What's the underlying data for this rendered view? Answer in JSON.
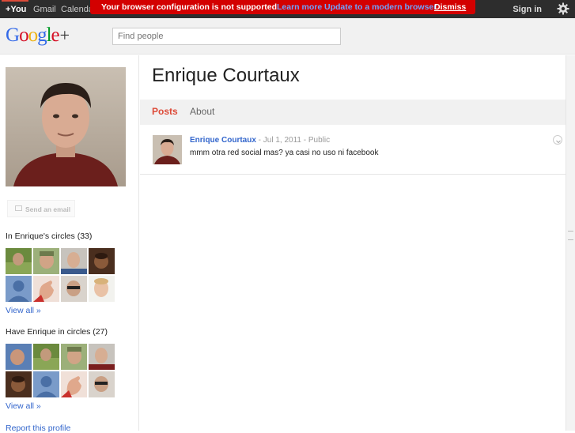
{
  "topbar": {
    "you": "+You",
    "gmail": "Gmail",
    "calendar": "Calendar",
    "signin": "Sign in",
    "settings_icon": "gear-icon"
  },
  "banner": {
    "message": "Your browser configuration is not supported.",
    "learn_more": "Learn more",
    "update": "Update to a modern browser",
    "dismiss": "Dismiss",
    "color": "#d30000"
  },
  "header": {
    "logo": {
      "g": "G",
      "o1": "o",
      "o2": "o",
      "g2": "g",
      "l": "l",
      "e": "e",
      "plus": "+"
    },
    "search_placeholder": "Find people"
  },
  "profile": {
    "name": "Enrique Courtaux",
    "send_email": "Send an email",
    "circles_title": "In Enrique's circles (33)",
    "have_in_circles_title": "Have Enrique in circles (27)",
    "view_all": "View all »",
    "report": "Report this profile"
  },
  "tabs": {
    "posts": "Posts",
    "about": "About",
    "active": "Posts"
  },
  "post": {
    "author": "Enrique Courtaux",
    "sep1": " - ",
    "date": "Jul 1, 2011",
    "sep2": " - ",
    "visibility": "Public",
    "text": "mmm otra red social mas? ya casi no uso ni facebook"
  },
  "colors": {
    "accent_red": "#dd4b39",
    "link_blue": "#3366cc"
  }
}
